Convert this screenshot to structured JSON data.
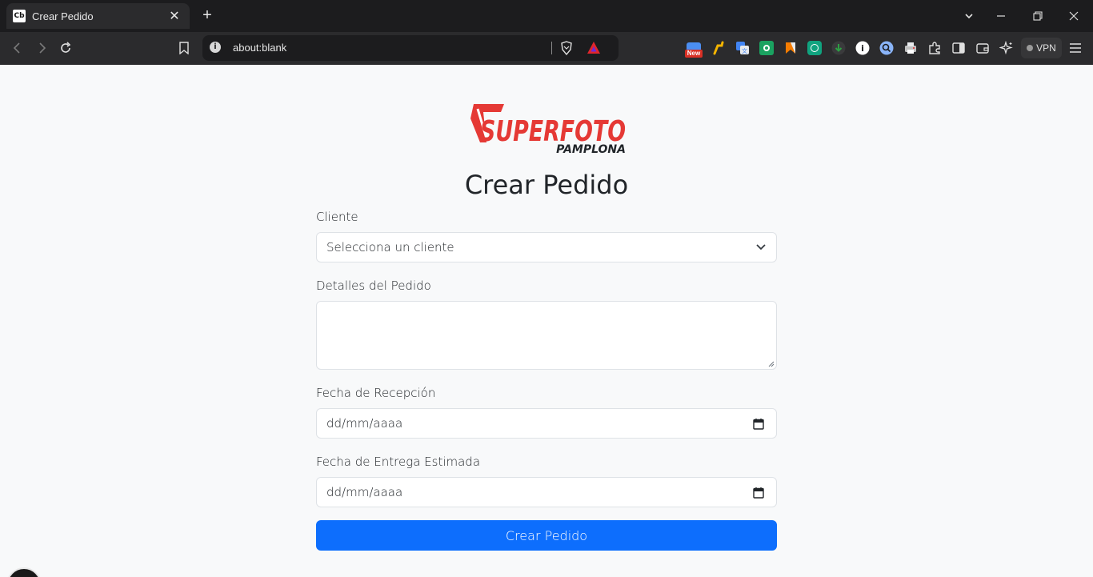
{
  "browser": {
    "tab": {
      "favicon_text": "Cb",
      "title": "Crear Pedido",
      "close_glyph": "✕"
    },
    "new_tab_glyph": "+",
    "url": "about:blank",
    "url_info_glyph": "i",
    "extensions": [
      {
        "name": "new-badge-extension-icon",
        "badge": "New",
        "color": "#d93025"
      },
      {
        "name": "bolt-extension-icon",
        "color": "#f4b400"
      },
      {
        "name": "translate-extension-icon",
        "color": "#4285f4"
      },
      {
        "name": "green-square-extension-icon",
        "color": "#1aa260"
      },
      {
        "name": "orange-flag-extension-icon",
        "color": "#f57c00"
      },
      {
        "name": "chatgpt-extension-icon",
        "color": "#10a37f"
      },
      {
        "name": "download-extension-icon",
        "color": "#2e7d32"
      },
      {
        "name": "info-circle-extension-icon",
        "color": "#ffffff"
      },
      {
        "name": "search-circle-extension-icon",
        "color": "#8ab4f8"
      },
      {
        "name": "printer-extension-icon",
        "color": "#c0c0c0"
      }
    ],
    "vpn_label": "VPN"
  },
  "page": {
    "logo": {
      "brand_top": "SUPERFOTO",
      "brand_bottom": "PAMPLONA",
      "brand_color": "#e53935"
    },
    "title": "Crear Pedido",
    "form": {
      "cliente_label": "Cliente",
      "cliente_selected": "Selecciona un cliente",
      "detalles_label": "Detalles del Pedido",
      "detalles_value": "",
      "fecha_recepcion_label": "Fecha de Recepción",
      "fecha_recepcion_value": "dd/mm/aaaa",
      "fecha_entrega_label": "Fecha de Entrega Estimada",
      "fecha_entrega_value": "dd/mm/aaaa",
      "submit_label": "Crear Pedido"
    },
    "accent_color": "#0d6efd"
  }
}
